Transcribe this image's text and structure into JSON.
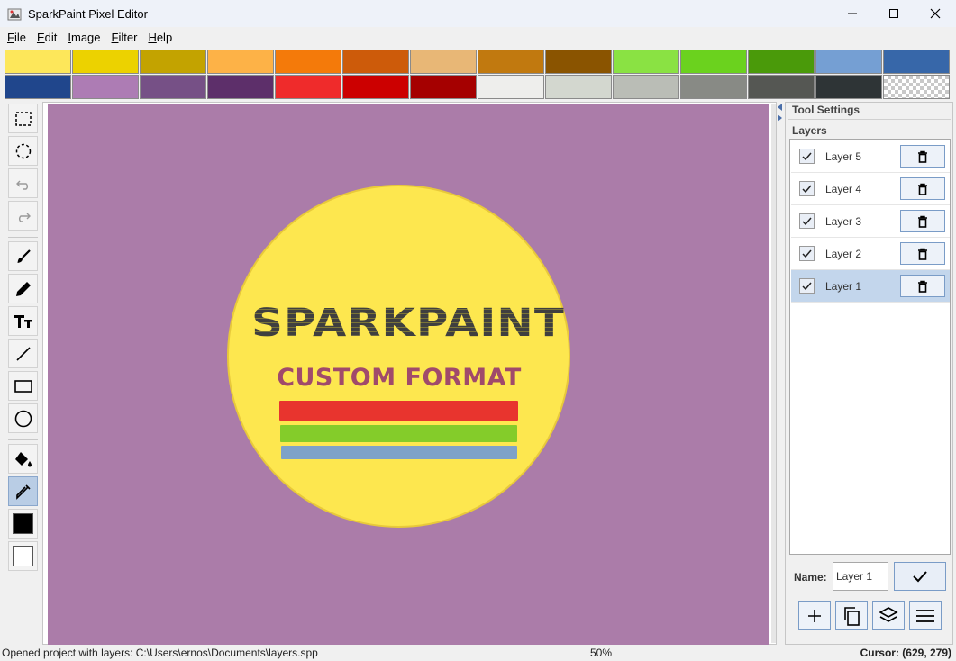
{
  "window": {
    "title": "SparkPaint Pixel Editor",
    "controls": [
      "minimize-icon",
      "maximize-icon",
      "close-icon"
    ]
  },
  "menu": [
    {
      "label": "File",
      "mnemonic": "F",
      "rest": "ile"
    },
    {
      "label": "Edit",
      "mnemonic": "E",
      "rest": "dit"
    },
    {
      "label": "Image",
      "mnemonic": "I",
      "rest": "mage"
    },
    {
      "label": "Filter",
      "mnemonic": "F",
      "rest": "ilter"
    },
    {
      "label": "Help",
      "mnemonic": "H",
      "rest": "elp"
    }
  ],
  "palette": {
    "row1": [
      "#fde75a",
      "#ecd200",
      "#c3a300",
      "#fdb247",
      "#f47a0a",
      "#cd5b0a",
      "#e8b776",
      "#c1790f",
      "#8a5400",
      "#8ae243",
      "#6bd21e",
      "#4a9a0a",
      "#759fd3",
      "#3767a9"
    ],
    "row2": [
      "#20468c",
      "#ad7cb4",
      "#765086",
      "#5d2f6a",
      "#ef2b2b",
      "#cc0000",
      "#a50000",
      "#eeeeec",
      "#d3d7cf",
      "#babdb6",
      "#888a85",
      "#555753",
      "#2e3436",
      "transparent"
    ]
  },
  "tools": [
    {
      "name": "rect-select-icon",
      "active": false
    },
    {
      "name": "lasso-select-icon",
      "active": false
    },
    {
      "name": "undo-icon",
      "active": false
    },
    {
      "name": "redo-icon",
      "active": false
    },
    {
      "name": "brush-icon",
      "active": false
    },
    {
      "name": "pencil-icon",
      "active": false
    },
    {
      "name": "text-tool-icon",
      "active": false
    },
    {
      "name": "line-tool-icon",
      "active": false
    },
    {
      "name": "rectangle-tool-icon",
      "active": false
    },
    {
      "name": "ellipse-tool-icon",
      "active": false
    },
    {
      "name": "fill-bucket-icon",
      "active": false
    },
    {
      "name": "color-picker-icon",
      "active": true
    }
  ],
  "colors": {
    "foreground": "#000000",
    "background": "#ffffff",
    "canvas_bg": "#ab7ca9",
    "accent": "#c3d6ec"
  },
  "canvas": {
    "logo_title": "SPARKPAINT",
    "logo_subtitle": "CUSTOM FORMAT",
    "stripes": [
      "#e8342e",
      "#84cc2a",
      "#7ea2c8"
    ]
  },
  "right_panel": {
    "tool_settings_label": "Tool Settings",
    "layers_label": "Layers",
    "layers": [
      {
        "name": "Layer 5",
        "visible": true,
        "selected": false
      },
      {
        "name": "Layer 4",
        "visible": true,
        "selected": false
      },
      {
        "name": "Layer 3",
        "visible": true,
        "selected": false
      },
      {
        "name": "Layer 2",
        "visible": true,
        "selected": false
      },
      {
        "name": "Layer 1",
        "visible": true,
        "selected": true
      }
    ],
    "name_label": "Name:",
    "name_value": "Layer 1",
    "actions": [
      "add-layer-icon",
      "duplicate-layer-icon",
      "merge-layers-icon",
      "layer-menu-icon"
    ]
  },
  "status": {
    "message": "Opened project with layers: C:\\Users\\ernos\\Documents\\layers.spp",
    "zoom": "50%",
    "cursor": "Cursor: (629, 279)"
  }
}
